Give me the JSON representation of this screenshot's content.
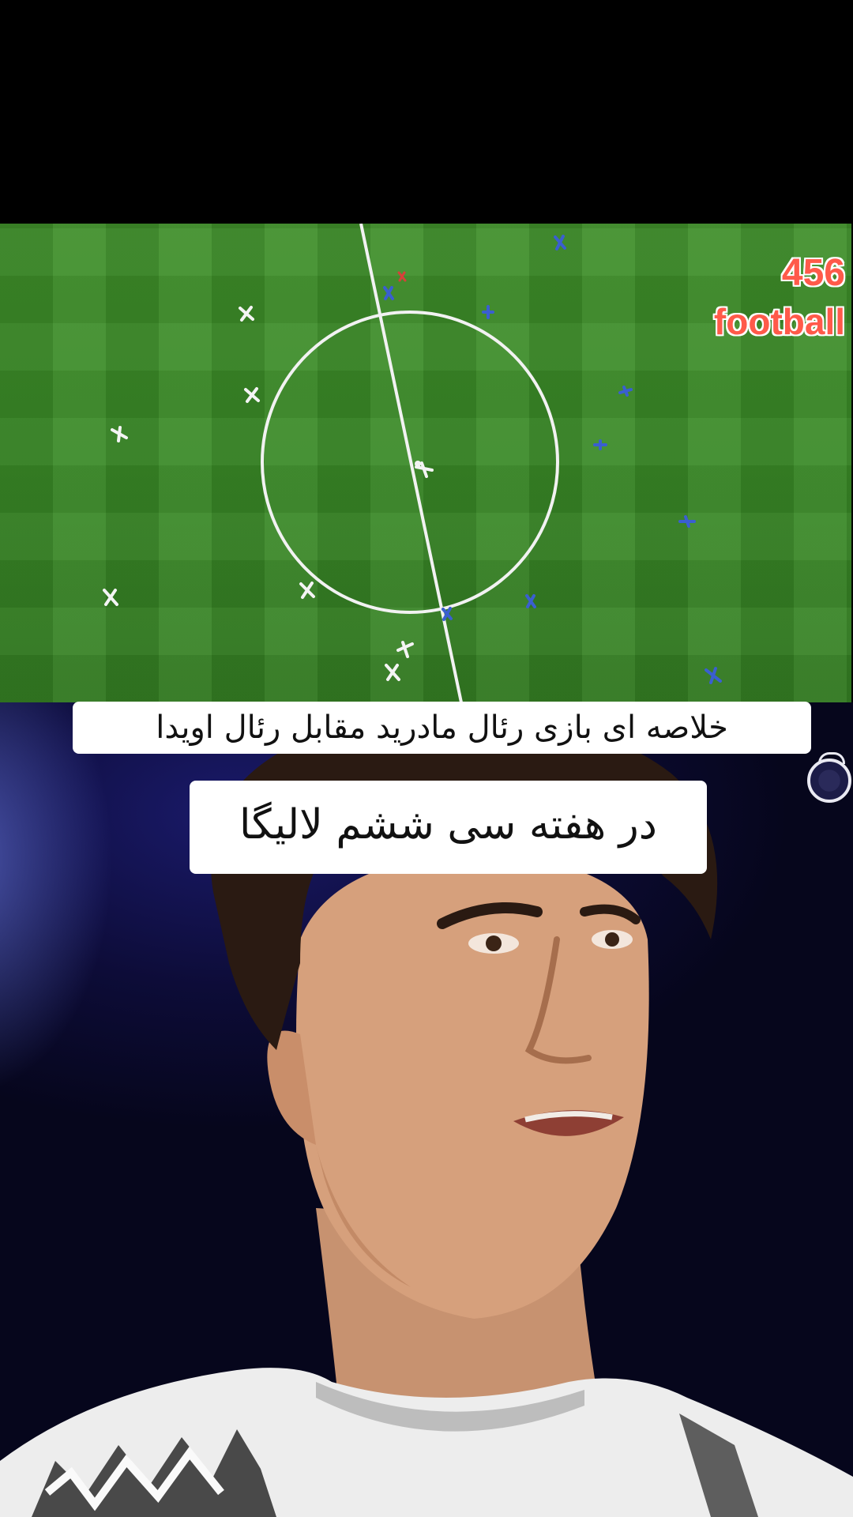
{
  "video": {
    "watermark": {
      "number": "456",
      "word": "football"
    },
    "caption_line_1": "خلاصه ای بازی رئال مادرید   مقابل رئال اویدا",
    "caption_line_2": "در هفته سی ششم لالیگا",
    "colors": {
      "pitch_green": "#3a8a27",
      "watermark_red": "#ff5a4a",
      "team_white": "#f4f4f4",
      "team_blue": "#3a5fd0",
      "backdrop_navy": "#0d0c38"
    },
    "icons": {
      "club_crest": "real-madrid-crest-icon"
    }
  }
}
